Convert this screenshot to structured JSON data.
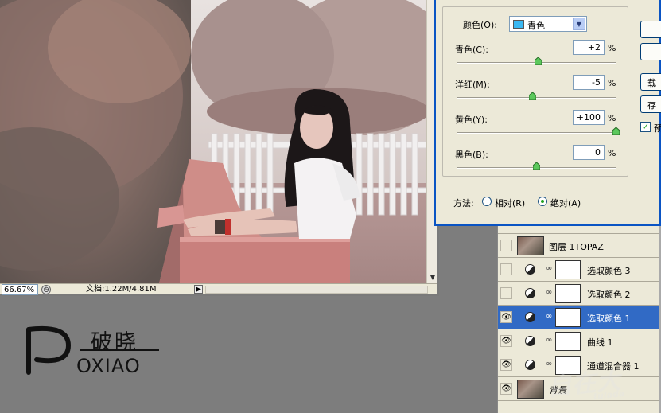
{
  "document": {
    "zoom": "66.67%",
    "doc_size": "文档:1.22M/4.81M"
  },
  "dialog": {
    "colors_label": "颜色(O):",
    "colors_value": "青色",
    "sliders": [
      {
        "label": "青色(C):",
        "value": "+2",
        "unit": "%",
        "level": 2
      },
      {
        "label": "洋红(M):",
        "value": "-5",
        "unit": "%",
        "level": -5
      },
      {
        "label": "黄色(Y):",
        "value": "+100",
        "unit": "%",
        "level": 100
      },
      {
        "label": "黑色(B):",
        "value": "0",
        "unit": "%",
        "level": 0
      }
    ],
    "method_label": "方法:",
    "method_relative": "相对(R)",
    "method_absolute": "绝对(A)",
    "method_selected": "absolute",
    "buttons": [
      "",
      "",
      "载",
      "存"
    ],
    "preview_label": "预"
  },
  "layers": [
    {
      "name": "图层 1TOPAZ",
      "kind": "photo",
      "visible": false,
      "selected": false
    },
    {
      "name": "选取颜色 3",
      "kind": "adjust",
      "visible": false,
      "selected": false
    },
    {
      "name": "选取颜色 2",
      "kind": "adjust",
      "visible": false,
      "selected": false
    },
    {
      "name": "选取颜色 1",
      "kind": "adjust",
      "visible": true,
      "selected": true
    },
    {
      "name": "曲线 1",
      "kind": "adjust",
      "visible": true,
      "selected": false
    },
    {
      "name": "通道混合器 1",
      "kind": "adjust",
      "visible": true,
      "selected": false
    },
    {
      "name": "背景",
      "kind": "photo",
      "visible": true,
      "selected": false
    }
  ],
  "logo": {
    "line1": "破晓",
    "line2": "OXIAO"
  },
  "watermark": {
    "text": "自在大",
    "sub": "tulada"
  },
  "colors": {
    "accent": "#316ac5",
    "swatch": "#3ab8f2",
    "dialog_border": "#0a54c4"
  }
}
